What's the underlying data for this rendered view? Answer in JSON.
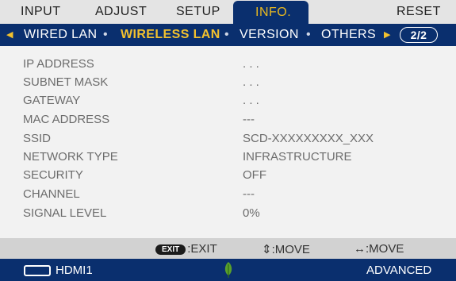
{
  "menu": {
    "tabs": [
      {
        "label": "INPUT"
      },
      {
        "label": "ADJUST"
      },
      {
        "label": "SETUP"
      },
      {
        "label": "INFO.",
        "active": true
      },
      {
        "label": "RESET"
      }
    ]
  },
  "submenu": {
    "items": [
      {
        "label": "WIRED LAN"
      },
      {
        "label": "WIRELESS LAN",
        "active": true
      },
      {
        "label": "VERSION"
      },
      {
        "label": "OTHERS"
      }
    ],
    "page": "2/2"
  },
  "info": {
    "rows": [
      {
        "label": "IP ADDRESS",
        "value": ". . ."
      },
      {
        "label": "SUBNET MASK",
        "value": ". . ."
      },
      {
        "label": "GATEWAY",
        "value": ". . ."
      },
      {
        "label": "MAC ADDRESS",
        "value": "---"
      },
      {
        "label": "SSID",
        "value": "SCD-XXXXXXXXX_XXX"
      },
      {
        "label": "NETWORK TYPE",
        "value": "INFRASTRUCTURE"
      },
      {
        "label": "SECURITY",
        "value": "OFF"
      },
      {
        "label": "CHANNEL",
        "value": "---"
      },
      {
        "label": "SIGNAL LEVEL",
        "value": "0%"
      }
    ]
  },
  "guide": {
    "exit_key": "EXIT",
    "exit_label": ":EXIT",
    "move_ud": "⇕:MOVE",
    "move_lr": "↔:MOVE"
  },
  "status": {
    "source": "HDMI1",
    "mode": "ADVANCED"
  },
  "icons": {
    "source": "hdmi-connector-icon",
    "eco": "leaf-icon"
  },
  "colors": {
    "accent": "#0a2f6e",
    "highlight": "#f2c12e",
    "eco_green": "#5aa02c"
  }
}
